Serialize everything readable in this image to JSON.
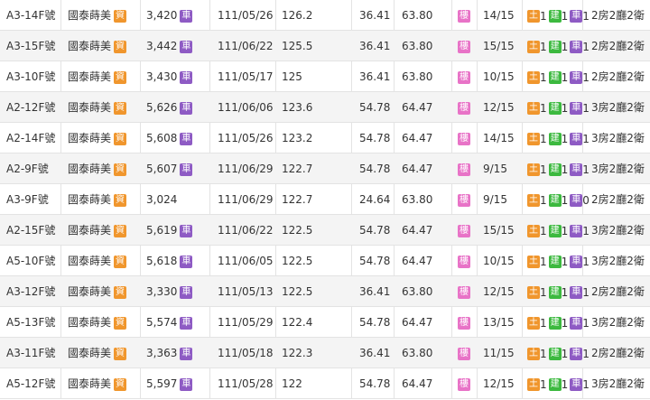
{
  "badges": {
    "capital": {
      "label": "資",
      "color": "#f0962d",
      "icon": "capital-badge-icon"
    },
    "parking": {
      "label": "車",
      "color": "#8e5bc4",
      "icon": "parking-badge-icon"
    },
    "floor": {
      "label": "樓",
      "color": "#e873c7",
      "icon": "building-badge-icon"
    },
    "land": {
      "label": "土",
      "color": "#f0962d"
    },
    "building": {
      "label": "建",
      "color": "#3cb93f"
    },
    "parking_count": {
      "label": "車",
      "color": "#8e5bc4"
    }
  },
  "rows": [
    {
      "unit": "A3-14F號",
      "community": "國泰蒔美",
      "price": "3,420",
      "parking": true,
      "date": "111/05/26",
      "unit_price": "126.2",
      "area": "36.41",
      "main_area": "63.80",
      "floor": "14/15",
      "land": "1",
      "bldg": "1",
      "car": "1",
      "layout": "2房2廳2衛"
    },
    {
      "unit": "A3-15F號",
      "community": "國泰蒔美",
      "price": "3,442",
      "parking": true,
      "date": "111/06/22",
      "unit_price": "125.5",
      "area": "36.41",
      "main_area": "63.80",
      "floor": "15/15",
      "land": "1",
      "bldg": "1",
      "car": "1",
      "layout": "2房2廳2衛"
    },
    {
      "unit": "A3-10F號",
      "community": "國泰蒔美",
      "price": "3,430",
      "parking": true,
      "date": "111/05/17",
      "unit_price": "125",
      "area": "36.41",
      "main_area": "63.80",
      "floor": "10/15",
      "land": "1",
      "bldg": "1",
      "car": "1",
      "layout": "2房2廳2衛"
    },
    {
      "unit": "A2-12F號",
      "community": "國泰蒔美",
      "price": "5,626",
      "parking": true,
      "date": "111/06/06",
      "unit_price": "123.6",
      "area": "54.78",
      "main_area": "64.47",
      "floor": "12/15",
      "land": "1",
      "bldg": "1",
      "car": "1",
      "layout": "3房2廳2衛"
    },
    {
      "unit": "A2-14F號",
      "community": "國泰蒔美",
      "price": "5,608",
      "parking": true,
      "date": "111/05/26",
      "unit_price": "123.2",
      "area": "54.78",
      "main_area": "64.47",
      "floor": "14/15",
      "land": "1",
      "bldg": "1",
      "car": "1",
      "layout": "3房2廳2衛"
    },
    {
      "unit": "A2-9F號",
      "community": "國泰蒔美",
      "price": "5,607",
      "parking": true,
      "date": "111/06/29",
      "unit_price": "122.7",
      "area": "54.78",
      "main_area": "64.47",
      "floor": "9/15",
      "land": "1",
      "bldg": "1",
      "car": "1",
      "layout": "3房2廳2衛"
    },
    {
      "unit": "A3-9F號",
      "community": "國泰蒔美",
      "price": "3,024",
      "parking": false,
      "date": "111/06/29",
      "unit_price": "122.7",
      "area": "24.64",
      "main_area": "63.80",
      "floor": "9/15",
      "land": "1",
      "bldg": "1",
      "car": "0",
      "layout": "2房2廳2衛"
    },
    {
      "unit": "A2-15F號",
      "community": "國泰蒔美",
      "price": "5,619",
      "parking": true,
      "date": "111/06/22",
      "unit_price": "122.5",
      "area": "54.78",
      "main_area": "64.47",
      "floor": "15/15",
      "land": "1",
      "bldg": "1",
      "car": "1",
      "layout": "3房2廳2衛"
    },
    {
      "unit": "A5-10F號",
      "community": "國泰蒔美",
      "price": "5,618",
      "parking": true,
      "date": "111/06/05",
      "unit_price": "122.5",
      "area": "54.78",
      "main_area": "64.47",
      "floor": "10/15",
      "land": "1",
      "bldg": "1",
      "car": "1",
      "layout": "3房2廳2衛"
    },
    {
      "unit": "A3-12F號",
      "community": "國泰蒔美",
      "price": "3,330",
      "parking": true,
      "date": "111/05/13",
      "unit_price": "122.5",
      "area": "36.41",
      "main_area": "63.80",
      "floor": "12/15",
      "land": "1",
      "bldg": "1",
      "car": "1",
      "layout": "2房2廳2衛"
    },
    {
      "unit": "A5-13F號",
      "community": "國泰蒔美",
      "price": "5,574",
      "parking": true,
      "date": "111/05/29",
      "unit_price": "122.4",
      "area": "54.78",
      "main_area": "64.47",
      "floor": "13/15",
      "land": "1",
      "bldg": "1",
      "car": "1",
      "layout": "3房2廳2衛"
    },
    {
      "unit": "A3-11F號",
      "community": "國泰蒔美",
      "price": "3,363",
      "parking": true,
      "date": "111/05/18",
      "unit_price": "122.3",
      "area": "36.41",
      "main_area": "63.80",
      "floor": "11/15",
      "land": "1",
      "bldg": "1",
      "car": "1",
      "layout": "2房2廳2衛"
    },
    {
      "unit": "A5-12F號",
      "community": "國泰蒔美",
      "price": "5,597",
      "parking": true,
      "date": "111/05/28",
      "unit_price": "122",
      "area": "54.78",
      "main_area": "64.47",
      "floor": "12/15",
      "land": "1",
      "bldg": "1",
      "car": "1",
      "layout": "3房2廳2衛"
    }
  ]
}
